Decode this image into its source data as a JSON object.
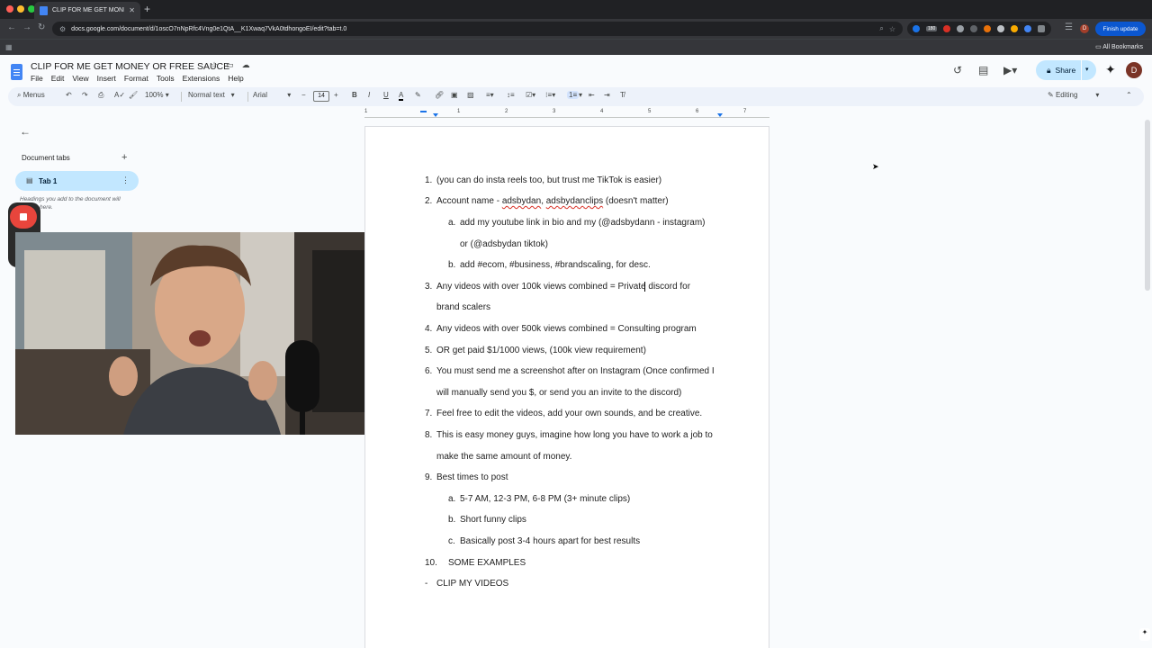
{
  "browser": {
    "tab_title": "CLIP FOR ME GET MONEY OR FREE SAUCE - Google Docs",
    "new_tab": "+",
    "url": "docs.google.com/document/d/1oscO7nNpRfc4Vng0e1QtA__K1Xwaq7VkA0tdhongoEI/edit?tab=t.0",
    "finish_update": "Finish update",
    "all_bookmarks": "All Bookmarks",
    "profile_initial": "D",
    "ext_badge": "180"
  },
  "doc": {
    "title": "CLIP FOR ME GET MONEY OR FREE SAUCE",
    "menu": [
      "File",
      "Edit",
      "View",
      "Insert",
      "Format",
      "Tools",
      "Extensions",
      "Help"
    ],
    "share_label": "Share",
    "avatar_initial": "D"
  },
  "toolbar": {
    "menus_label": "Menus",
    "zoom": "100%",
    "style": "Normal text",
    "font": "Arial",
    "font_size": "14",
    "mode": "Editing"
  },
  "ruler": {
    "numbers": [
      "1",
      "1",
      "2",
      "3",
      "4",
      "5",
      "6",
      "7"
    ]
  },
  "side_panel": {
    "section_label": "Document tabs",
    "tab_label": "Tab 1",
    "hint": "Headings you add to the document will appear here."
  },
  "content": {
    "lines": [
      {
        "marker": "1.",
        "text": "(you can do insta reels too, but trust me TikTok is easier)"
      },
      {
        "marker": "2.",
        "pre": "Account name - ",
        "s1": "adsbydan",
        "mid": ", ",
        "s2": "adsbydanclips",
        "post": " (doesn't matter)"
      },
      {
        "marker": "a.",
        "text": "add my youtube link in bio and my (@adsbydann - instagram)"
      },
      {
        "marker": "",
        "text": "or (@adsbydan tiktok)"
      },
      {
        "marker": "b.",
        "text": "add #ecom, #business, #brandscaling, for desc."
      },
      {
        "marker": "3.",
        "text": "Any videos with over 100k views combined = Private discord for"
      },
      {
        "marker": "",
        "text": "brand scalers"
      },
      {
        "marker": "4.",
        "text": "Any videos with over 500k views combined = Consulting program"
      },
      {
        "marker": "5.",
        "text": "OR get paid $1/1000 views, (100k view requirement)"
      },
      {
        "marker": "6.",
        "text": "You must send me a screenshot after on Instagram (Once confirmed I"
      },
      {
        "marker": "",
        "text": "will manually send you $, or send you an invite to the discord)"
      },
      {
        "marker": "7.",
        "text": "Feel free to edit the videos, add your own sounds, and be creative."
      },
      {
        "marker": "8.",
        "text": "This is easy money guys, imagine how long you have to work a job to"
      },
      {
        "marker": "",
        "text": "make the same amount of money."
      },
      {
        "marker": "9.",
        "text": "Best times to post"
      },
      {
        "marker": "a.",
        "text": "5-7 AM, 12-3 PM, 6-8 PM (3+ minute clips)"
      },
      {
        "marker": "b.",
        "text": "Short funny clips"
      },
      {
        "marker": "c.",
        "text": "Basically post 3-4 hours apart for best results"
      },
      {
        "marker": "10.",
        "text": "SOME EXAMPLES"
      },
      {
        "marker": "-",
        "text": "CLIP MY VIDEOS"
      }
    ]
  },
  "colors": {
    "accent": "#0b57d0",
    "share_bg": "#c2e7ff",
    "record_red": "#e8453c"
  }
}
